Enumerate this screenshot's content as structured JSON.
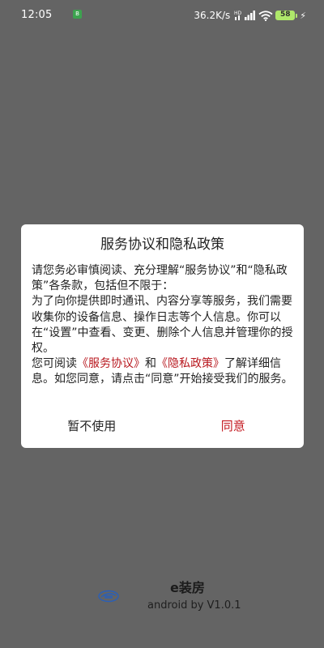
{
  "status_bar": {
    "time": "12:05",
    "notification_badge": "B",
    "net_speed": "36.2K/s",
    "battery_level": "58",
    "battery_color": "#aee86a",
    "icons": [
      "hd-signal-icon",
      "signal-icon",
      "wifi-icon",
      "battery-icon",
      "charging-icon"
    ]
  },
  "dialog": {
    "title": "服务协议和隐私政策",
    "paragraph_1": "请您务必审慎阅读、充分理解“服务协议”和“隐私政策”各条款，包括但不限于：",
    "paragraph_2": "为了向你提供即时通讯、内容分享等服务，我们需要收集你的设备信息、操作日志等个人信息。你可以在“设置”中查看、变更、删除个人信息并管理你的授权。",
    "paragraph_3_prefix": "您可阅读",
    "service_link": "《服务协议》",
    "paragraph_3_and": "和",
    "privacy_link": "《隐私政策》",
    "paragraph_3_suffix": "了解详细信息。如您同意，请点击“同意”开始接受我们的服务。",
    "decline_label": "暂不使用",
    "agree_label": "同意",
    "accent_color": "#c3161c"
  },
  "brand": {
    "logo_icon": "e-zhuangfang-logo-icon",
    "app_name": "e装房",
    "version": "android by V1.0.1"
  },
  "colors": {
    "overlay_background": "#646464",
    "dialog_background": "#ffffff"
  }
}
